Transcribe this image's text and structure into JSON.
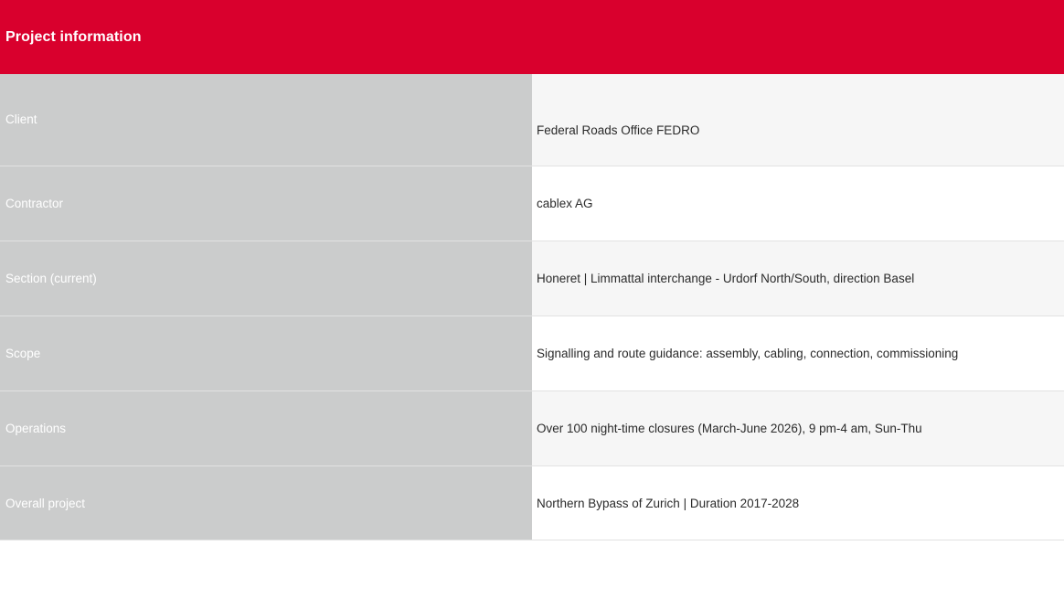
{
  "header": {
    "title": "Project information",
    "color": "#d9002d"
  },
  "rows": [
    {
      "label": "Client",
      "value": "Federal Roads Office FEDRO"
    },
    {
      "label": "Contractor",
      "value": "cablex AG"
    },
    {
      "label": "Section (current)",
      "value": "Honeret | Limmattal interchange - Urdorf North/South, direction Basel"
    },
    {
      "label": "Scope",
      "value": "Signalling and route guidance: assembly, cabling, connection, commissioning"
    },
    {
      "label": "Operations",
      "value": "Over 100 night-time closures (March-June 2026), 9 pm-4 am, Sun-Thu"
    },
    {
      "label": "Overall project",
      "value": "Northern Bypass of Zurich | Duration 2017-2028"
    }
  ]
}
